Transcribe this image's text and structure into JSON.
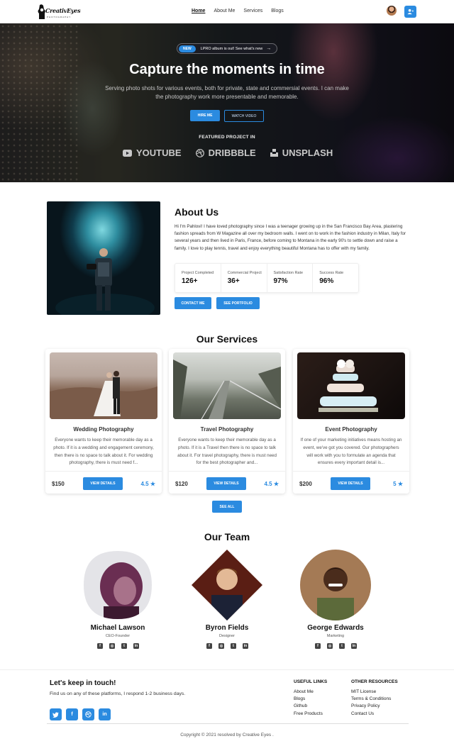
{
  "nav": {
    "logo_text": "CreativEyes",
    "logo_sub": "PHOTOGRAPHY",
    "links": [
      "Home",
      "About Me",
      "Services",
      "Blogs"
    ]
  },
  "hero": {
    "pill_badge": "NEW",
    "pill_text": "LPRO album is out! See what's new",
    "pill_arrow": "→",
    "title": "Capture the moments in time",
    "subtitle": "Serving photo shots for various events, both for private, state and commersial events. I can make the photography work more presentable and memorable.",
    "hire_label": "HIRE ME",
    "watch_label": "WATCH VIDEO",
    "featured_label": "FEATURED PROJECT IN",
    "brands": [
      "YOUTUBE",
      "DRIBBBLE",
      "UNSPLASH"
    ]
  },
  "about": {
    "title": "About Us",
    "text": "Hi I'm Pahlovi! I have loved photography since I was a teenager growing up in the San Francisco Bay Area, plastering fashion spreads from W Magazine all over my bedroom walls. I went on to work in the fashion industry in Milan, Italy for several years and then lived in Paris, France, before coming to Montana in the early 90's to settle down and raise a family. I love to play tennis, travel and enjoy everything beautiful Montana has to offer with my family.",
    "stats": [
      {
        "label": "Project Completed",
        "value": "126+"
      },
      {
        "label": "Commercial Project",
        "value": "36+"
      },
      {
        "label": "Satisfaction Rate",
        "value": "97%"
      },
      {
        "label": "Success Rate",
        "value": "96%"
      }
    ],
    "contact_label": "CONTACT ME",
    "portfolio_label": "SEE PORTFOLIO"
  },
  "services": {
    "title": "Our Services",
    "cards": [
      {
        "title": "Wedding Photography",
        "desc": "Everyone wants to keep their memorable day as a photo. If it is a wedding and engagement ceremony, then there is no space to talk about it. For wedding photography, there is must need f...",
        "price": "$150",
        "button": "VIEW DETAILS",
        "rating": "4.5"
      },
      {
        "title": "Travel Photography",
        "desc": "Everyone wants to keep their memorable day as a photo. If it is a Travel then there is no space to talk about it. For travel photography, there is must need for the best photographer and...",
        "price": "$120",
        "button": "VIEW DETAILS",
        "rating": "4.5"
      },
      {
        "title": "Event Photography",
        "desc": "If one of your marketing initiatives means hosting an event, we've got you covered. Our photographers will work with you to formulate an agenda that ensures every important detail is...",
        "price": "$200",
        "button": "VIEW DETAILS",
        "rating": "5"
      }
    ],
    "see_all_label": "SEE ALL"
  },
  "team": {
    "title": "Our Team",
    "members": [
      {
        "name": "Michael Lawson",
        "role": "CEO-Founder"
      },
      {
        "name": "Byron Fields",
        "role": "Designer"
      },
      {
        "name": "George Edwards",
        "role": "Marketing"
      }
    ]
  },
  "footer": {
    "title": "Let's keep in touch!",
    "subtitle": "Find us on any of these platforms, I respond 1-2 business days.",
    "useful_title": "USEFUL LINKS",
    "useful_links": [
      "About Me",
      "Blogs",
      "Github",
      "Free Products"
    ],
    "other_title": "OTHER RESOURCES",
    "other_links": [
      "MIT License",
      "Terms & Conditions",
      "Privacy Policy",
      "Contact Us"
    ],
    "copyright": "Copyright © 2021 resolved by Creative Eyes ."
  },
  "colors": {
    "accent": "#2b8be0"
  }
}
